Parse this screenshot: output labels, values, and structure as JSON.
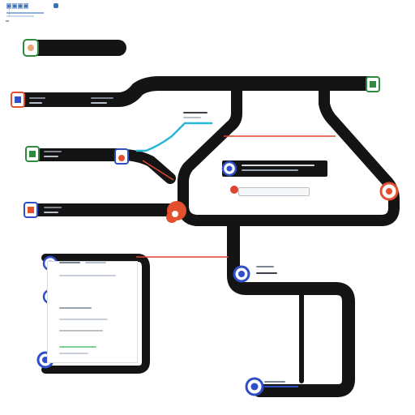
{
  "diagram": {
    "accent_colors": {
      "track": "#141414",
      "red_link": "#e0432f",
      "cyan_link": "#2bb6d9",
      "blue_node": "#2e4fc8",
      "green_node": "#2f8c3e",
      "orange_node": "#e2502e"
    },
    "nodes": [
      {
        "id": "n1",
        "icon": "green-document-icon"
      },
      {
        "id": "n2",
        "icon": "orange-document-icon"
      },
      {
        "id": "n3",
        "icon": "green-document-icon"
      },
      {
        "id": "n4",
        "icon": "orange-document-icon"
      },
      {
        "id": "n5",
        "icon": "blue-document-icon"
      },
      {
        "id": "n6",
        "icon": "blue-circle-icon"
      },
      {
        "id": "n7",
        "icon": "blue-document-icon"
      },
      {
        "id": "n8",
        "icon": "green-document-icon"
      },
      {
        "id": "n9",
        "icon": "orange-junction-icon"
      },
      {
        "id": "n10",
        "icon": "orange-document-icon"
      },
      {
        "id": "n11",
        "icon": "blue-circle-icon"
      },
      {
        "id": "n12",
        "icon": "blue-circle-icon"
      },
      {
        "id": "n13",
        "icon": "blue-circle-icon"
      },
      {
        "id": "n14",
        "icon": "blue-circle-icon"
      },
      {
        "id": "n15",
        "icon": "red-dot-icon"
      }
    ]
  }
}
